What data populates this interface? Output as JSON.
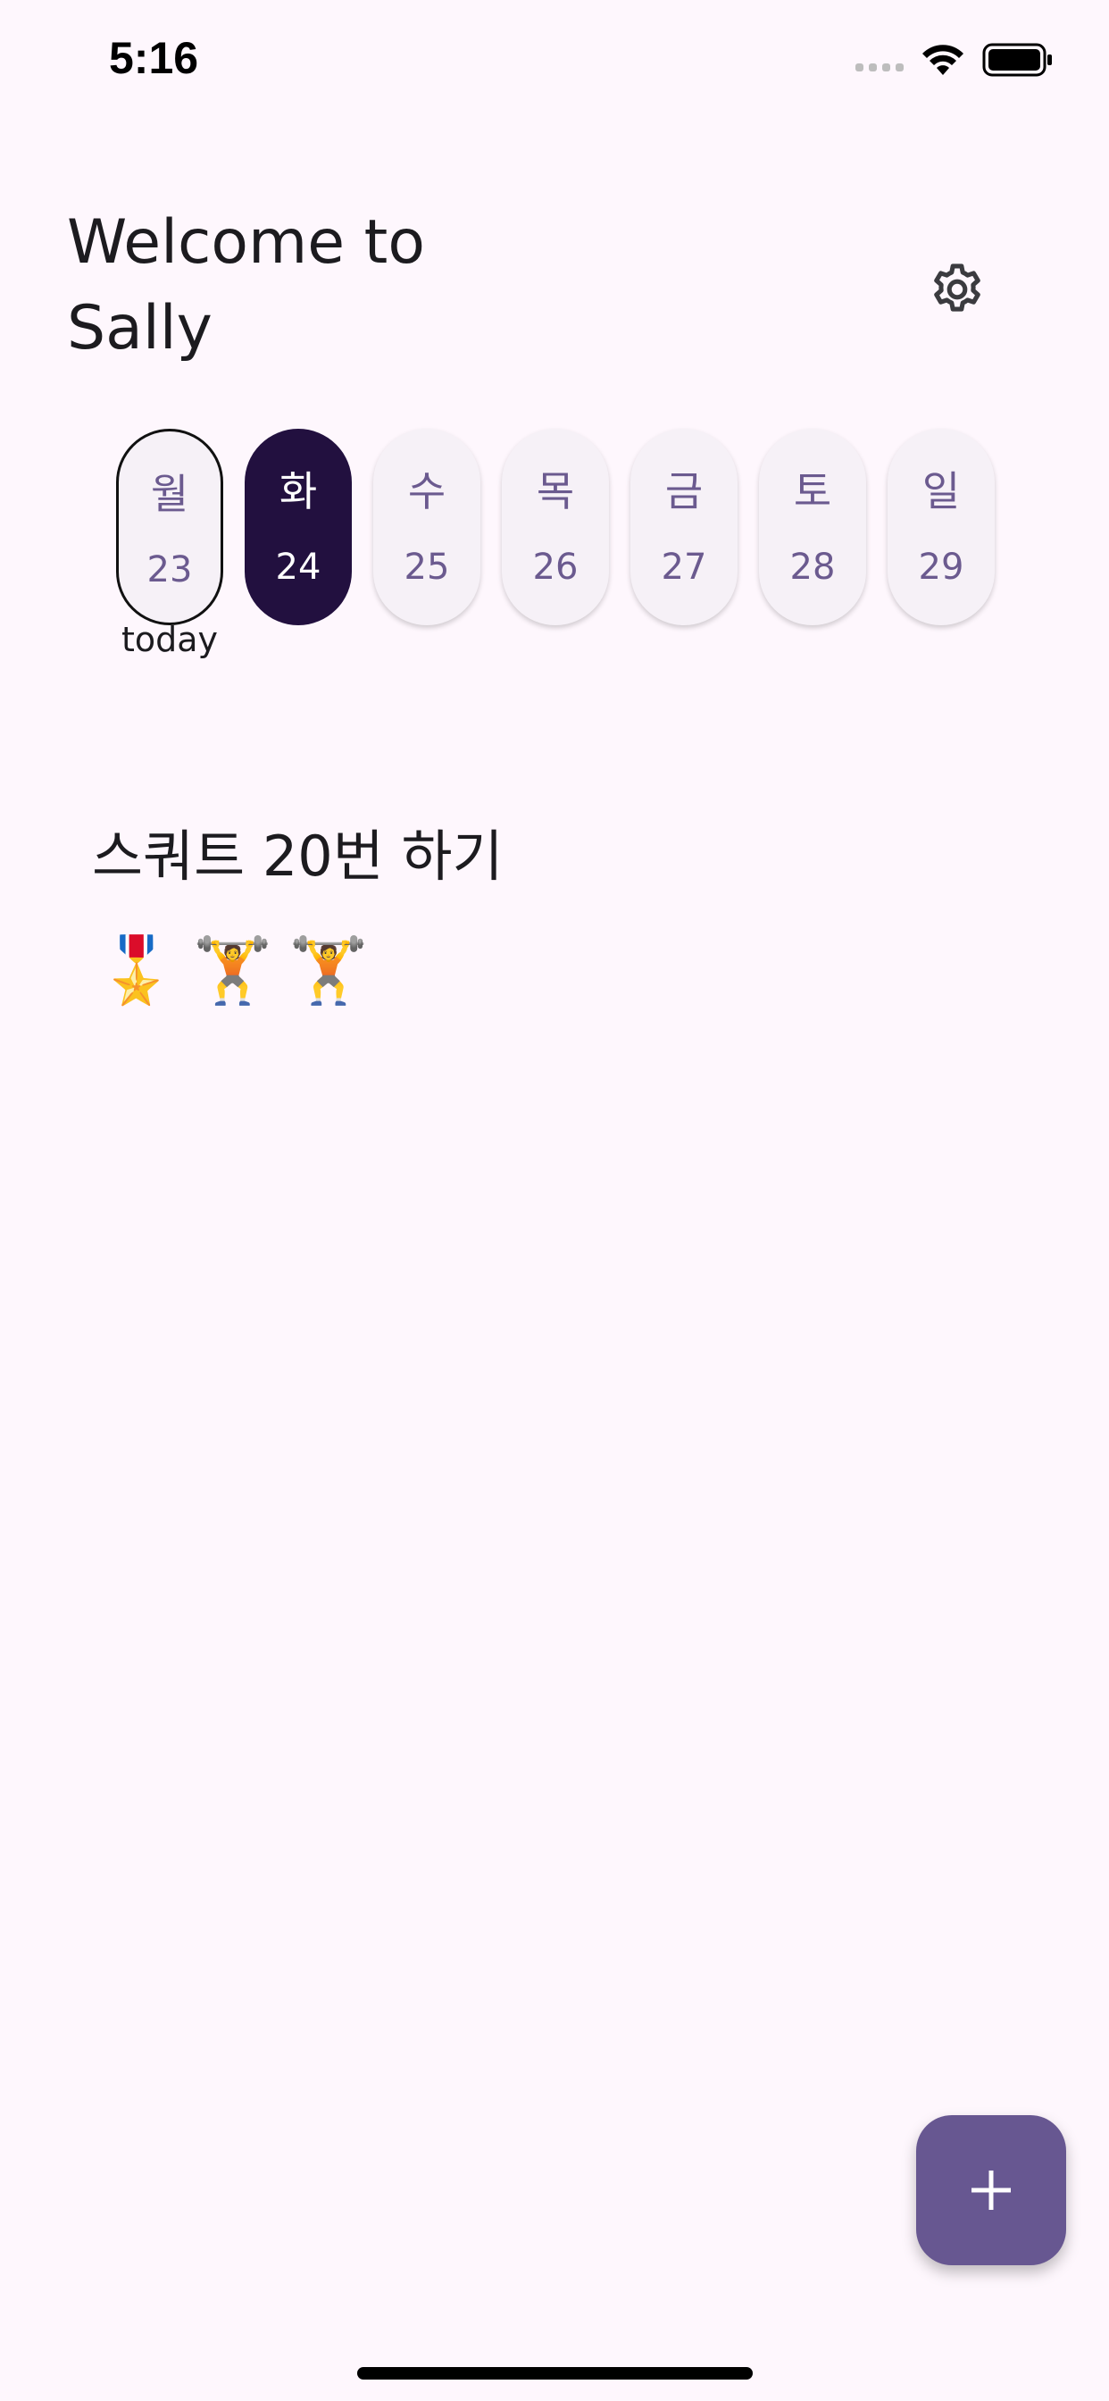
{
  "status_bar": {
    "time": "5:16"
  },
  "header": {
    "title": "Welcome to Sally"
  },
  "week": {
    "today_label": "today",
    "days": [
      {
        "name": "월",
        "date": "23",
        "today": true,
        "selected": false
      },
      {
        "name": "화",
        "date": "24",
        "today": false,
        "selected": true
      },
      {
        "name": "수",
        "date": "25",
        "today": false,
        "selected": false
      },
      {
        "name": "목",
        "date": "26",
        "today": false,
        "selected": false
      },
      {
        "name": "금",
        "date": "27",
        "today": false,
        "selected": false
      },
      {
        "name": "토",
        "date": "28",
        "today": false,
        "selected": false
      },
      {
        "name": "일",
        "date": "29",
        "today": false,
        "selected": false
      }
    ]
  },
  "habit": {
    "title": "스쿼트 20번 하기",
    "badges": [
      "🎖️",
      "🏋️",
      "🏋️"
    ]
  },
  "colors": {
    "background": "#fef7fd",
    "selected_day": "#22103f",
    "fab": "#675791",
    "day_text": "#6b5a8f"
  },
  "icons": {
    "settings": "gear-icon",
    "fab": "plus-icon",
    "wifi": "wifi-icon",
    "battery": "battery-icon"
  }
}
